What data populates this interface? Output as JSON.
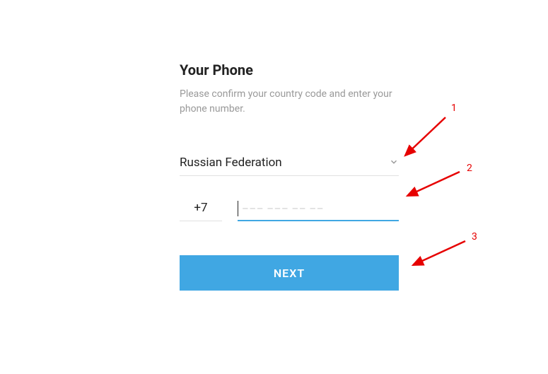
{
  "title": "Your Phone",
  "subtitle": "Please confirm your country code and enter your phone number.",
  "country": {
    "name": "Russian Federation",
    "code": "+7"
  },
  "phone": {
    "placeholder": "––– ––– –– ––",
    "value": ""
  },
  "next_button": "NEXT",
  "annotations": {
    "a1": "1",
    "a2": "2",
    "a3": "3"
  },
  "colors": {
    "accent": "#40a7e3",
    "annotation": "#e60000"
  }
}
